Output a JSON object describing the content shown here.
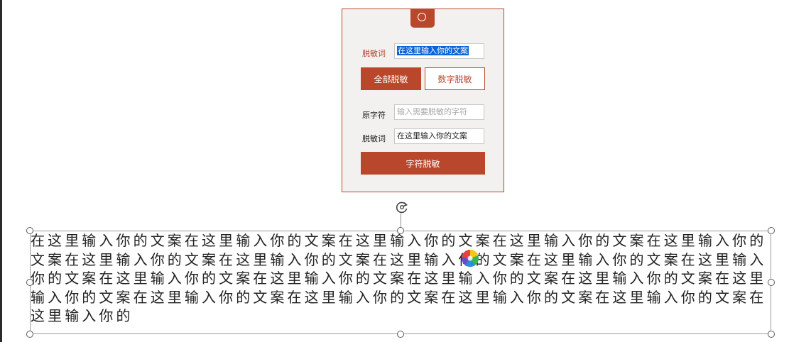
{
  "panel": {
    "tab_icon": "circle-icon",
    "mask_word_label": "脱敏词",
    "mask_word_value": "在这里输入你的文案",
    "full_mask_button": "全部脱敏",
    "digit_mask_button": "数字脱敏",
    "original_char_label": "原字符",
    "original_char_placeholder": "输入需要脱敏的字符",
    "mask_word_label_2": "脱敏词",
    "mask_word_value_2": "在这里输入你的文案",
    "char_mask_button": "字符脱敏"
  },
  "textbox": {
    "content": "在这里输入你的文案在这里输入你的文案在这里输入你的文案在这里输入你的文案在这里输入你的文案在这里输入你的文案在这里输入你的文案在这里输入你的文案在这里输入你的文案在这里输入你的文案在这里输入你的文案在这里输入你的文案在这里输入你的文案在这里输入你的文案在这里输入你的文案在这里输入你的文案在这里输入你的文案在这里输入你的文案在这里输入你的文案在这里输入你的",
    "rotate_icon": "rotate-icon"
  },
  "colors": {
    "accent": "#b9472b",
    "panel_bg": "#f3f1ef",
    "selection": "#0a64d8"
  }
}
